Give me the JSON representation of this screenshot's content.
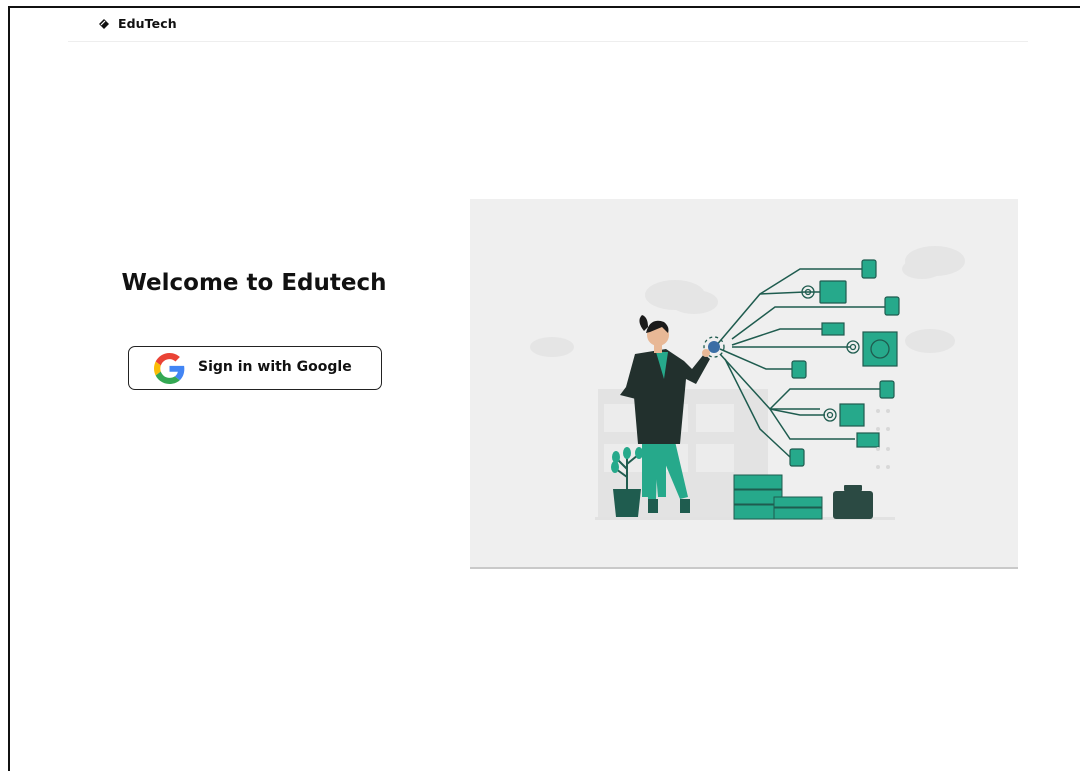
{
  "header": {
    "brand_name": "EduTech",
    "brand_icon": "diamond-logo-icon"
  },
  "main": {
    "welcome_title": "Welcome to Edutech",
    "google_button": {
      "label": "Sign in with Google",
      "icon": "google-g-icon"
    },
    "illustration": {
      "subject": "woman-with-technology-network-illustration"
    }
  },
  "colors": {
    "accent_teal": "#26a98b",
    "dark_teal": "#1f5c4f",
    "illustration_bg": "#efefef",
    "text": "#111111"
  }
}
